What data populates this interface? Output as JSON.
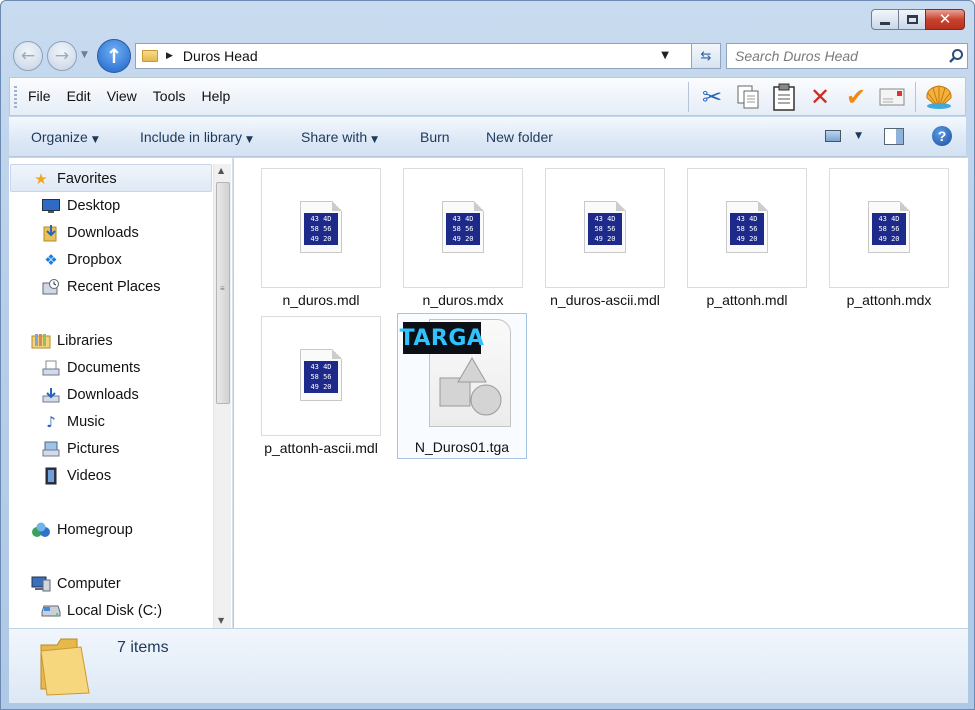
{
  "window": {
    "caption": {
      "minimize": "minimize",
      "maximize": "maximize",
      "close": "close"
    }
  },
  "address": {
    "path": "Duros Head",
    "search_placeholder": "Search Duros Head"
  },
  "menu": {
    "items": [
      {
        "label": "File"
      },
      {
        "label": "Edit"
      },
      {
        "label": "View"
      },
      {
        "label": "Tools"
      },
      {
        "label": "Help"
      }
    ],
    "toolbar_icons": [
      "cut-icon",
      "copy-icon",
      "paste-icon",
      "delete-icon",
      "properties-check-icon",
      "mail-icon",
      "shell-icon"
    ]
  },
  "command_bar": {
    "organize": "Organize",
    "include_in_library": "Include in library",
    "share_with": "Share with",
    "burn": "Burn",
    "new_folder": "New folder"
  },
  "nav_pane": {
    "favorites": {
      "label": "Favorites",
      "items": [
        {
          "label": "Desktop",
          "icon": "desktop-icon"
        },
        {
          "label": "Downloads",
          "icon": "downloads-icon"
        },
        {
          "label": "Dropbox",
          "icon": "dropbox-icon"
        },
        {
          "label": "Recent Places",
          "icon": "recent-places-icon"
        }
      ]
    },
    "libraries": {
      "label": "Libraries",
      "items": [
        {
          "label": "Documents",
          "icon": "documents-icon"
        },
        {
          "label": "Downloads",
          "icon": "downloads-icon"
        },
        {
          "label": "Music",
          "icon": "music-icon"
        },
        {
          "label": "Pictures",
          "icon": "pictures-icon"
        },
        {
          "label": "Videos",
          "icon": "videos-icon"
        }
      ]
    },
    "homegroup": {
      "label": "Homegroup"
    },
    "computer": {
      "label": "Computer",
      "items": [
        {
          "label": "Local Disk (C:)",
          "icon": "local-disk-icon"
        }
      ]
    }
  },
  "files": [
    {
      "name": "n_duros.mdl",
      "type": "hex"
    },
    {
      "name": "n_duros.mdx",
      "type": "hex"
    },
    {
      "name": "n_duros-ascii.mdl",
      "type": "hex"
    },
    {
      "name": "p_attonh.mdl",
      "type": "hex"
    },
    {
      "name": "p_attonh.mdx",
      "type": "hex"
    },
    {
      "name": "p_attonh-ascii.mdl",
      "type": "hex"
    },
    {
      "name": "N_Duros01.tga",
      "type": "tga",
      "selected": true,
      "badge": "TARGA"
    }
  ],
  "hex_icon_text": [
    "43 4D",
    "58 56",
    "49 20"
  ],
  "status": {
    "text": "7 items"
  },
  "colors": {
    "accent": "#1e395b",
    "selection": "#a8c4e5",
    "close_button": "#c8432f"
  }
}
